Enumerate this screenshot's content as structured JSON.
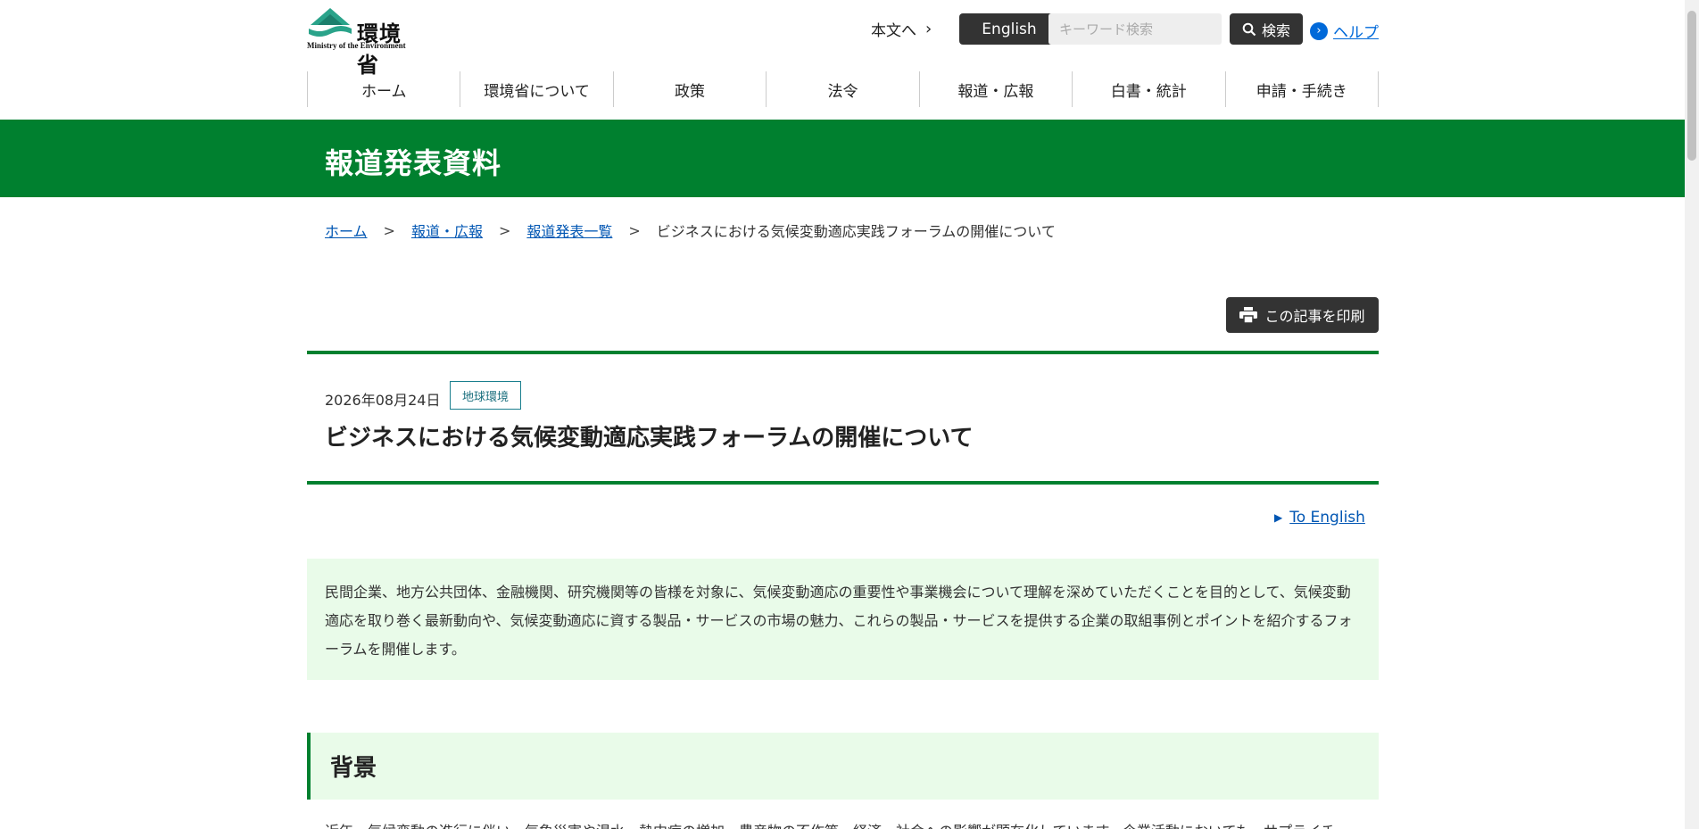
{
  "header": {
    "logo_jp": "環境省",
    "logo_en": "Ministry of the Environment",
    "skip_link": "本文へ",
    "english_button": "English",
    "search_placeholder": "キーワード検索",
    "search_button": "検索",
    "help_link": "ヘルプ"
  },
  "gnav": {
    "items": [
      "ホーム",
      "環境省について",
      "政策",
      "法令",
      "報道・広報",
      "白書・統計",
      "申請・手続き"
    ]
  },
  "band": {
    "title": "報道発表資料"
  },
  "breadcrumb": {
    "items": [
      "ホーム",
      "報道・広報",
      "報道発表一覧"
    ],
    "separator": ">",
    "current": "ビジネスにおける気候変動適応実践フォーラムの開催について"
  },
  "print_button": "この記事を印刷",
  "article": {
    "date": "2026年08月24日",
    "tag": "地球環境",
    "title": "ビジネスにおける気候変動適応実践フォーラムの開催について",
    "to_english": "To English",
    "summary": "民間企業、地方公共団体、金融機関、研究機関等の皆様を対象に、気候変動適応の重要性や事業機会について理解を深めていただくことを目的として、気候変動適応を取り巻く最新動向や、気候変動適応に資する製品・サービスの市場の魅力、これらの製品・サービスを提供する企業の取組事例とポイントを紹介するフォーラムを開催します。",
    "section_heading": "背景",
    "section_body_start": "近年、気候変動の進行に伴い、気象災害や渇水、熱中症の増加、農産物の不作等、経済・社会への影響が顕在化しています。企業活動においても、サプライチ"
  },
  "colors": {
    "brand_green": "#00802f",
    "summary_bg": "#e9fbe9",
    "link_blue": "#0056b3",
    "dark_button": "#333333"
  }
}
